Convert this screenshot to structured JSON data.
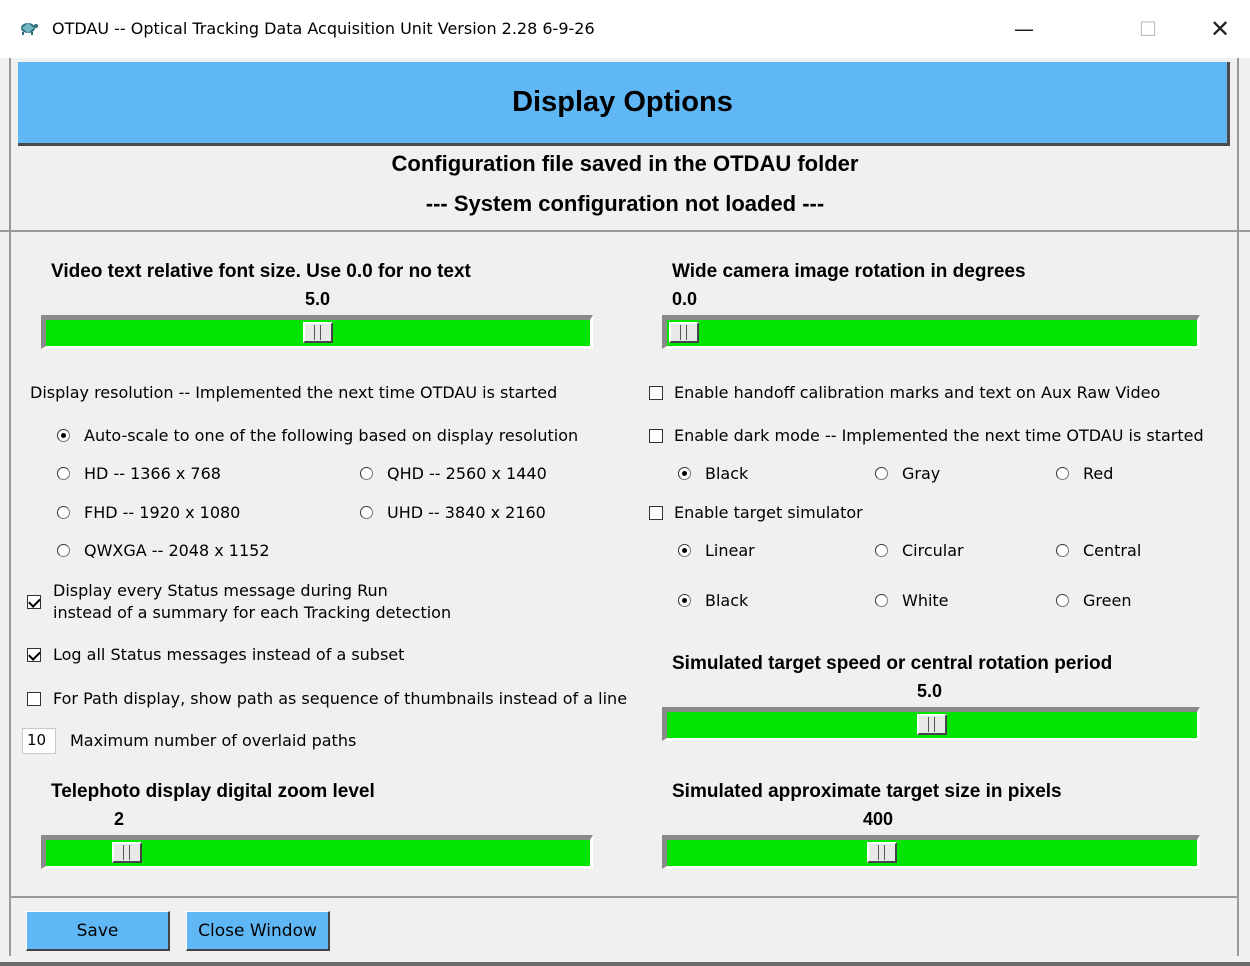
{
  "window": {
    "title": "OTDAU -- Optical Tracking Data Acquisition Unit    Version 2.28 6-9-26",
    "minimize_glyph": "—",
    "maximize_glyph": "☐",
    "close_glyph": "✕",
    "app_icon": "turtle-icon"
  },
  "header": {
    "title": "Display Options",
    "config_status": "Configuration file saved in the OTDAU folder",
    "system_status": "--- System configuration not loaded ---"
  },
  "sliders": {
    "font_size": {
      "label": "Video text relative font size. Use 0.0 for no text",
      "value": "5.0",
      "fraction": 0.5
    },
    "rotation": {
      "label": "Wide camera image rotation in degrees",
      "value": "0.0",
      "fraction": 0.0
    },
    "zoom": {
      "label": "Telephoto display digital zoom level",
      "value": "2",
      "fraction": 0.125
    },
    "target_speed": {
      "label": "Simulated target speed or central rotation period",
      "value": "5.0",
      "fraction": 0.5
    },
    "target_size": {
      "label": "Simulated approximate target size in pixels",
      "value": "400",
      "fraction": 0.4
    }
  },
  "resolution": {
    "label": "Display resolution -- Implemented the next time OTDAU is started",
    "options": [
      {
        "label": "Auto-scale to one of the following based on display resolution",
        "selected": true
      },
      {
        "label": "HD -- 1366 x 768",
        "selected": false
      },
      {
        "label": "QHD -- 2560 x 1440",
        "selected": false
      },
      {
        "label": "FHD -- 1920 x 1080",
        "selected": false
      },
      {
        "label": "UHD -- 3840 x 2160",
        "selected": false
      },
      {
        "label": "QWXGA -- 2048 x 1152",
        "selected": false
      }
    ]
  },
  "left_checkboxes": {
    "status_every_line1": "Display every Status message during Run",
    "status_every_line2": "instead of a summary for each Tracking detection",
    "status_every_checked": true,
    "log_all": "Log all Status messages instead of a subset",
    "log_all_checked": true,
    "path_thumbnails": "For Path display, show path as sequence of thumbnails instead of a line",
    "path_thumbnails_checked": false
  },
  "max_paths": {
    "value": "10",
    "label": "Maximum number of overlaid paths"
  },
  "right_options": {
    "handoff_marks": "Enable handoff calibration marks and text on Aux Raw Video",
    "handoff_marks_checked": false,
    "dark_mode": "Enable dark mode -- Implemented the next time OTDAU is started",
    "dark_mode_checked": false,
    "dark_colors": [
      {
        "label": "Black",
        "selected": true
      },
      {
        "label": "Gray",
        "selected": false
      },
      {
        "label": "Red",
        "selected": false
      }
    ],
    "target_sim": "Enable target simulator",
    "target_sim_checked": false,
    "motion": [
      {
        "label": "Linear",
        "selected": true
      },
      {
        "label": "Circular",
        "selected": false
      },
      {
        "label": "Central",
        "selected": false
      }
    ],
    "target_colors": [
      {
        "label": "Black",
        "selected": true
      },
      {
        "label": "White",
        "selected": false
      },
      {
        "label": "Green",
        "selected": false
      }
    ]
  },
  "buttons": {
    "save": "Save",
    "close": "Close Window"
  },
  "colors": {
    "banner": "#5fb8f5",
    "slider_fill": "#00e400",
    "button": "#5fb8f5"
  }
}
